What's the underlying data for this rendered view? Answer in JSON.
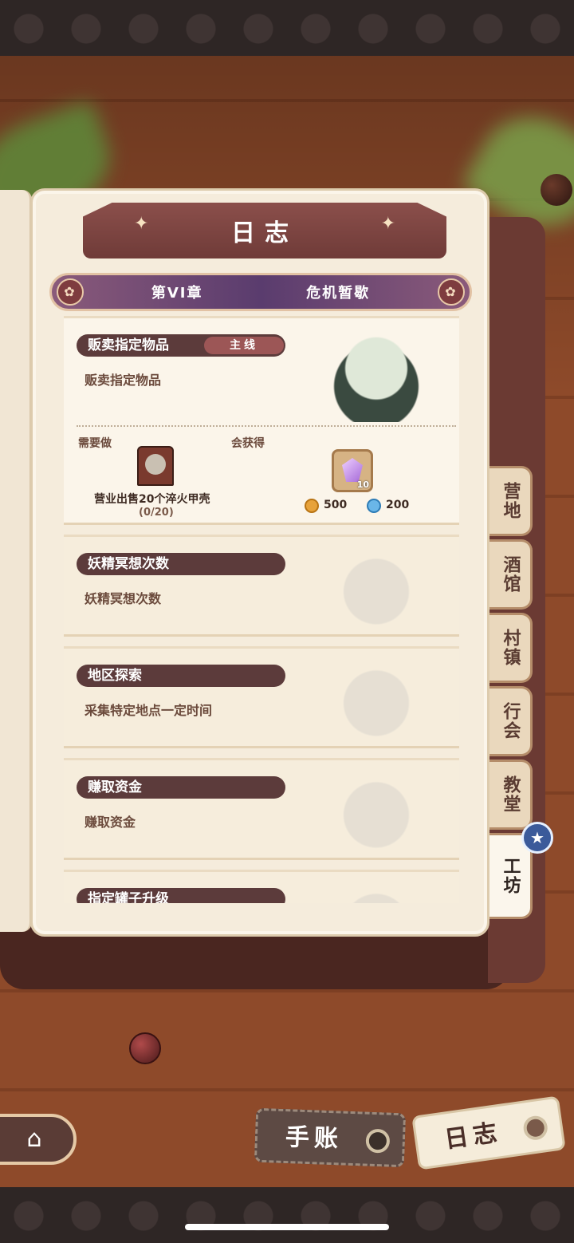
{
  "header": {
    "title": "日志"
  },
  "chapter": {
    "number": "第VI章",
    "name": "危机暂歇"
  },
  "main_quest": {
    "title": "贩卖指定物品",
    "tag": "主线",
    "description": "贩卖指定物品",
    "need_label": "需要做",
    "reward_label": "会获得",
    "requirement": "营业出售20个淬火甲壳",
    "progress": "(0/20)",
    "item_quantity": "10",
    "coins": "500",
    "gems": "200"
  },
  "quests": [
    {
      "title": "妖精冥想次数",
      "description": "妖精冥想次数"
    },
    {
      "title": "地区探索",
      "description": "采集特定地点一定时间"
    },
    {
      "title": "赚取资金",
      "description": "赚取资金"
    },
    {
      "title": "指定罐子升级",
      "description": ""
    }
  ],
  "side_tabs": [
    "营地",
    "酒馆",
    "村镇",
    "行会",
    "教堂",
    "工坊"
  ],
  "active_tab": "工坊",
  "bottom": {
    "notebook_label": "手账",
    "log_label": "日志"
  },
  "colors": {
    "wood": "#8e4a2a",
    "page": "#f5ecdc",
    "ribbon": "#8b4f4b",
    "title_bar": "#5c3b3b",
    "accent_purple": "#5a3c6e"
  }
}
